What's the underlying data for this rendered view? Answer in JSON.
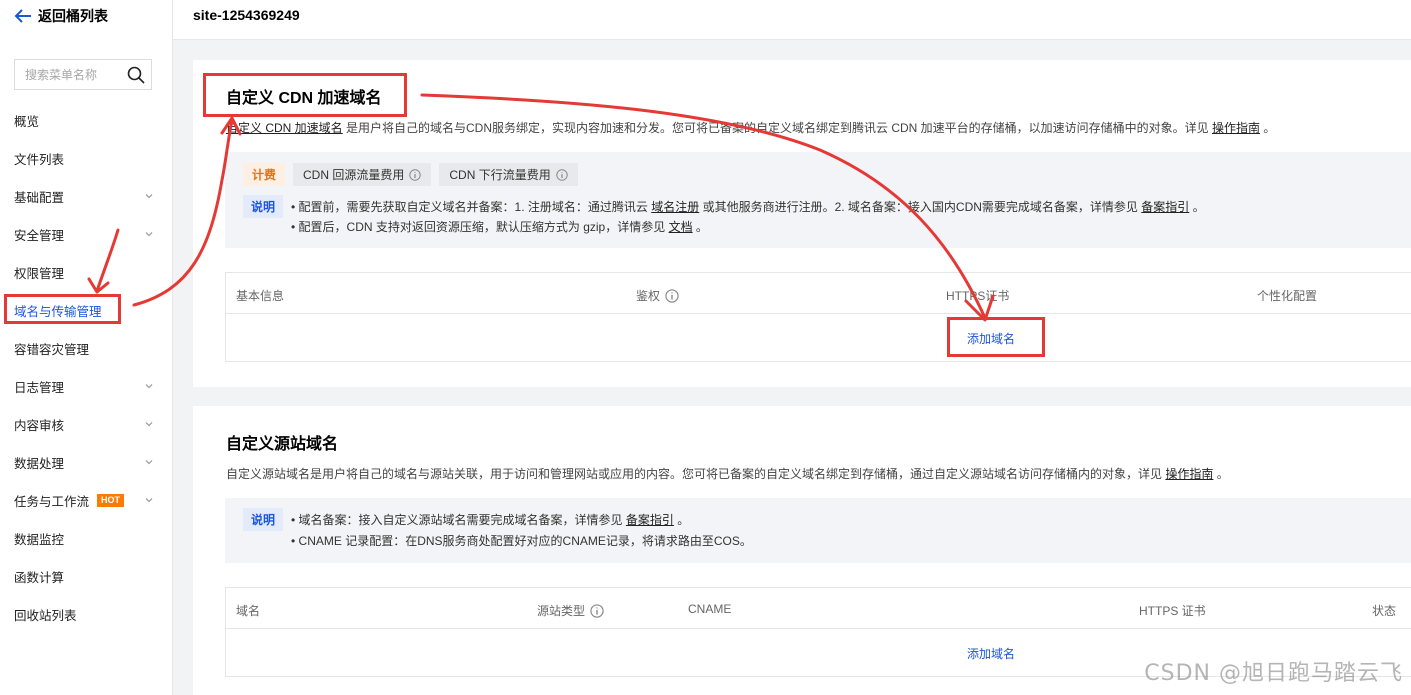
{
  "sidebar": {
    "back_label": "返回桶列表",
    "search_placeholder": "搜索菜单名称",
    "items": [
      {
        "label": "概览"
      },
      {
        "label": "文件列表"
      },
      {
        "label": "基础配置"
      },
      {
        "label": "安全管理"
      },
      {
        "label": "权限管理"
      },
      {
        "label": "域名与传输管理"
      },
      {
        "label": "容错容灾管理"
      },
      {
        "label": "日志管理"
      },
      {
        "label": "内容审核"
      },
      {
        "label": "数据处理"
      },
      {
        "label": "任务与工作流",
        "badge": "HOT"
      },
      {
        "label": "数据监控"
      },
      {
        "label": "函数计算"
      },
      {
        "label": "回收站列表"
      }
    ]
  },
  "header": {
    "bucket_name": "site-1254369249"
  },
  "cdn_section": {
    "title": "自定义 CDN 加速域名",
    "desc_link": "自定义 CDN 加速域名",
    "desc_text": " 是用户将自己的域名与CDN服务绑定，实现内容加速和分发。您可将已备案的自定义域名绑定到腾讯云 CDN 加速平台的存储桶，以加速访问存储桶中的对象。详见 ",
    "desc_guide": "操作指南",
    "desc_end": " 。",
    "billing_tag": "计费",
    "fee_1": "CDN 回源流量费用",
    "fee_2": "CDN 下行流量费用",
    "note_tag": "说明",
    "note_1_a": "• 配置前，需要先获取自定义域名并备案：1. 注册域名：通过腾讯云 ",
    "note_1_link1": "域名注册",
    "note_1_b": " 或其他服务商进行注册。2. 域名备案：接入国内CDN需要完成域名备案，详情参见 ",
    "note_1_link2": "备案指引",
    "note_1_c": " 。",
    "note_2_a": "• 配置后，CDN 支持对返回资源压缩，默认压缩方式为 gzip，详情参见 ",
    "note_2_link": "文档",
    "note_2_c": " 。",
    "table_headers": [
      "基本信息",
      "鉴权",
      "HTTPS证书",
      "个性化配置"
    ],
    "add_domain": "添加域名"
  },
  "origin_section": {
    "title": "自定义源站域名",
    "desc_text": "自定义源站域名是用户将自己的域名与源站关联，用于访问和管理网站或应用的内容。您可将已备案的自定义域名绑定到存储桶，通过自定义源站域名访问存储桶内的对象，详见 ",
    "desc_guide": "操作指南",
    "desc_end": " 。",
    "note_tag": "说明",
    "note_1_a": "• 域名备案：接入自定义源站域名需要完成域名备案，详情参见 ",
    "note_1_link": "备案指引",
    "note_1_c": " 。",
    "note_2": "• CNAME 记录配置：在DNS服务商处配置好对应的CNAME记录，将请求路由至COS。",
    "table_headers": [
      "域名",
      "源站类型",
      "CNAME",
      "HTTPS 证书",
      "状态"
    ],
    "add_domain": "添加域名"
  },
  "watermark": "CSDN @旭日跑马踏云飞",
  "colors": {
    "accent": "#1a56db",
    "annotation": "#e53935",
    "hot": "#ff7a00",
    "billing": "#e37318"
  }
}
